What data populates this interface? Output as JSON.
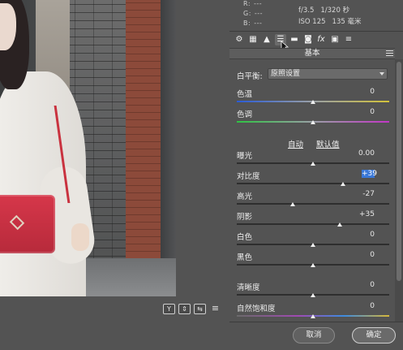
{
  "readout": {
    "r_label": "R:",
    "r_value": "---",
    "g_label": "G:",
    "g_value": "---",
    "b_label": "B:",
    "b_value": "---",
    "aperture": "f/3.5",
    "shutter": "1/320 秒",
    "iso": "ISO 125",
    "focal": "135 毫米"
  },
  "tabs": [
    "basic-tone-icon",
    "tone-curve-icon",
    "detail-icon",
    "hsl-icon",
    "split-tone-icon",
    "lens-icon",
    "fx-icon",
    "camera-calibration-icon",
    "presets-icon"
  ],
  "panel": {
    "title": "基本",
    "white_balance_label": "白平衡:",
    "white_balance_value": "原照设置",
    "auto_label": "自动",
    "default_label": "默认值"
  },
  "sliders": [
    {
      "label": "色温",
      "value": "0",
      "position": 0.5
    },
    {
      "label": "色调",
      "value": "0",
      "position": 0.5
    },
    {
      "label": "曝光",
      "value": "0.00",
      "position": 0.5
    },
    {
      "label": "对比度",
      "value": "+39",
      "position": 0.695
    },
    {
      "label": "高光",
      "value": "-27",
      "position": 0.365
    },
    {
      "label": "阴影",
      "value": "+35",
      "position": 0.675
    },
    {
      "label": "白色",
      "value": "0",
      "position": 0.5
    },
    {
      "label": "黑色",
      "value": "0",
      "position": 0.5
    },
    {
      "label": "清晰度",
      "value": "0",
      "position": 0.5
    },
    {
      "label": "自然饱和度",
      "value": "0",
      "position": 0.5
    }
  ],
  "view_tools": [
    "Y",
    "⇕",
    "⇆",
    "≡"
  ],
  "buttons": {
    "cancel": "取消",
    "ok": "确定"
  },
  "colors": {
    "panel_bg": "#535353",
    "highlight": "#3a78d8"
  }
}
